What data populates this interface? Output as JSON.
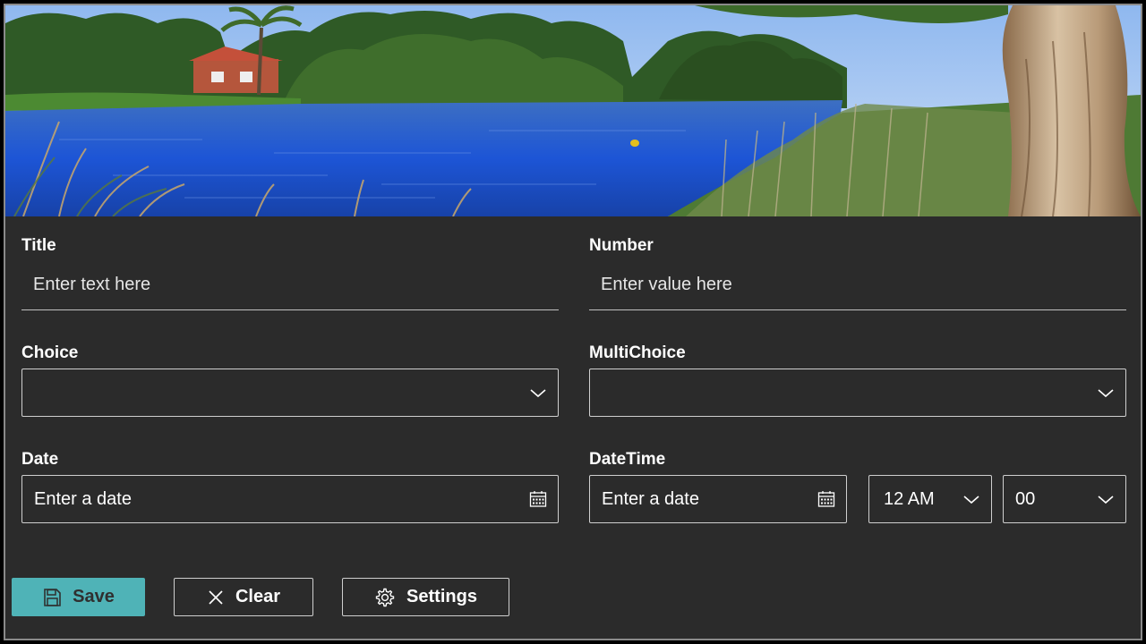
{
  "form": {
    "title": {
      "label": "Title",
      "placeholder": "Enter text here"
    },
    "number": {
      "label": "Number",
      "placeholder": "Enter value here"
    },
    "choice": {
      "label": "Choice",
      "value": ""
    },
    "multichoice": {
      "label": "MultiChoice",
      "value": ""
    },
    "date": {
      "label": "Date",
      "placeholder": "Enter a date"
    },
    "datetime": {
      "label": "DateTime",
      "placeholder": "Enter a date",
      "hour": "12 AM",
      "minute": "00"
    }
  },
  "actions": {
    "save_label": "Save",
    "clear_label": "Clear",
    "settings_label": "Settings"
  },
  "icons": {
    "save": "save-icon",
    "clear": "close-icon",
    "settings": "gear-icon",
    "calendar": "calendar-icon",
    "dropdown": "chevron-down-icon"
  },
  "colors": {
    "background": "#2b2b2b",
    "accent": "#4fb3b7",
    "text": "#ffffff"
  }
}
